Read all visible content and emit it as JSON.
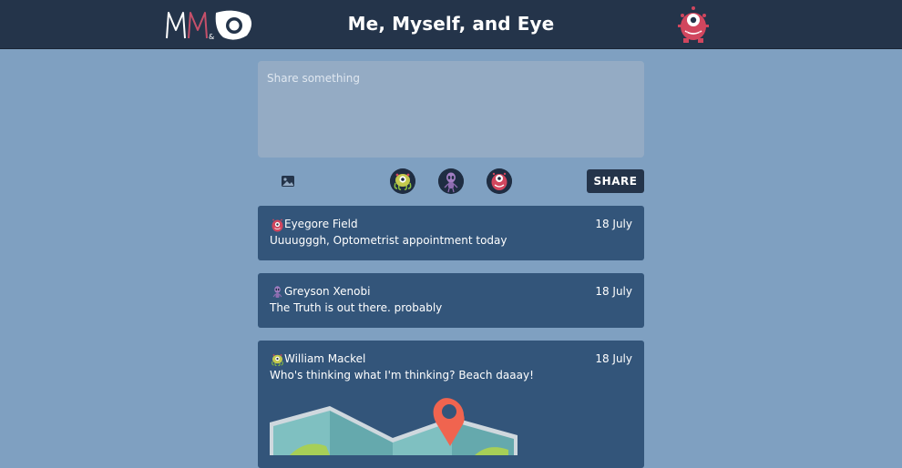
{
  "app": {
    "title": "Me, Myself, and Eye",
    "logo_icon": "mme-eye-logo",
    "profile_icon": "pink-eye-monster-icon"
  },
  "composer": {
    "placeholder": "Share something",
    "value": "",
    "image_icon": "image-icon",
    "characters": [
      {
        "icon": "green-tentacle-monster-icon"
      },
      {
        "icon": "purple-alien-icon"
      },
      {
        "icon": "pink-eye-monster-icon"
      }
    ],
    "share_label": "SHARE"
  },
  "posts": [
    {
      "author": "Eyegore Field",
      "avatar_icon": "pink-eye-monster-icon",
      "date": "18 July",
      "text": "Uuuugggh, Optometrist appointment today"
    },
    {
      "author": "Greyson Xenobi",
      "avatar_icon": "purple-alien-icon",
      "date": "18 July",
      "text": "The Truth is out there. probably"
    },
    {
      "author": "William Mackel",
      "avatar_icon": "green-tentacle-monster-icon",
      "date": "18 July",
      "text": "Who's thinking what I'm thinking? Beach daaay!",
      "image_icon": "map-pin-icon"
    }
  ],
  "colors": {
    "background": "#7fa0c1",
    "topbar": "#24344a",
    "post_card": "#33557a",
    "composer": "#94abc4",
    "accent_pink": "#d1465e",
    "map_pin": "#f0644f"
  }
}
